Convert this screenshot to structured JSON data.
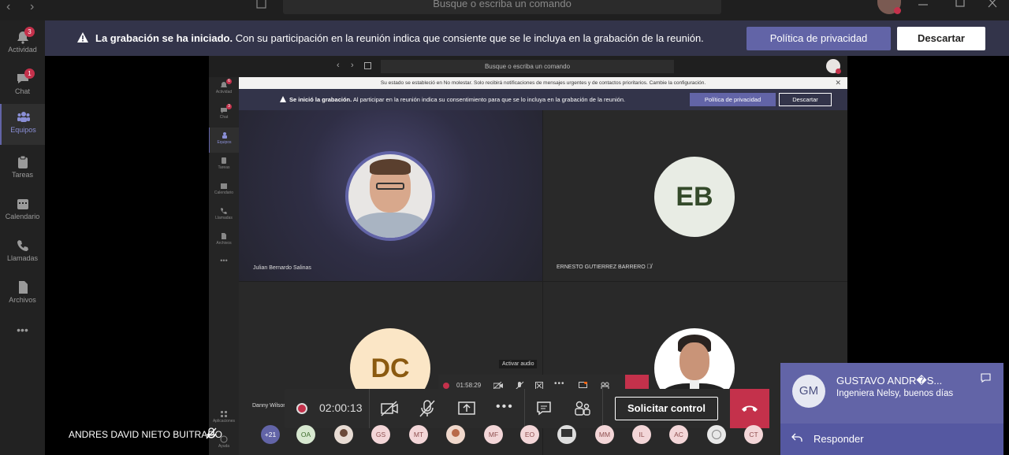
{
  "titlebar": {
    "search_placeholder": "Busque o escriba un comando"
  },
  "rail": {
    "items": [
      {
        "label": "Actividad",
        "badge": "3"
      },
      {
        "label": "Chat",
        "badge": "1"
      },
      {
        "label": "Equipos",
        "badge": ""
      },
      {
        "label": "Tareas",
        "badge": ""
      },
      {
        "label": "Calendario",
        "badge": ""
      },
      {
        "label": "Llamadas",
        "badge": ""
      },
      {
        "label": "Archivos",
        "badge": ""
      },
      {
        "label": "•••",
        "badge": ""
      }
    ]
  },
  "banner": {
    "bold": "La grabación se ha iniciado.",
    "text": " Con su participación en la reunión indica que consiente que se le incluya en la grabación de la reunión.",
    "privacy": "Política de privacidad",
    "dismiss": "Descartar"
  },
  "inner": {
    "search": "Busque o escriba un comando",
    "notice": "Su estado se estableció en No molestar. Solo recibirá notificaciones de mensajes urgentes y de contactos prioritarios. Cambie la configuración.",
    "banner_bold": "Se inició la grabación.",
    "banner_text": " Al participar en la reunión indica su consentimiento para que se lo incluya en la grabación de la reunión.",
    "privacy": "Política de privacidad",
    "dismiss": "Descartar",
    "rail": [
      "Actividad",
      "Chat",
      "Equipos",
      "Tareas",
      "Calendario",
      "Llamadas",
      "Archivos",
      "•••"
    ],
    "rail_badges": [
      "6",
      "3",
      "",
      "",
      "",
      "",
      "",
      ""
    ],
    "tiles": [
      {
        "name": "Julian Bernardo Salinas"
      },
      {
        "name": "ERNESTO GUTIERREZ BARRERO",
        "initials": "EB"
      },
      {
        "name": "Danny Wilson",
        "initials": "DC"
      },
      {
        "name": ""
      }
    ],
    "mini_timer": "01:58:29",
    "tooltip": "Activar audio",
    "apps": "Aplicaciones",
    "help": "Ayuda"
  },
  "callbar": {
    "timer": "02:00:13",
    "control": "Solicitar control"
  },
  "participants": {
    "overflow": "+21",
    "initials": [
      "OA",
      "",
      "GS",
      "MT",
      "",
      "MF",
      "EO",
      "",
      "MM",
      "IL",
      "AC",
      "",
      "CT"
    ]
  },
  "self": {
    "name": "ANDRES DAVID NIETO BUITRAGO"
  },
  "toast": {
    "initials": "GM",
    "sender": "GUSTAVO ANDR�S...",
    "message": "Ingeniera Nelsy, buenos días",
    "reply": "Responder"
  },
  "colors": {
    "accent": "#6264a7",
    "hangup": "#c4314b",
    "banner": "#33344a"
  }
}
